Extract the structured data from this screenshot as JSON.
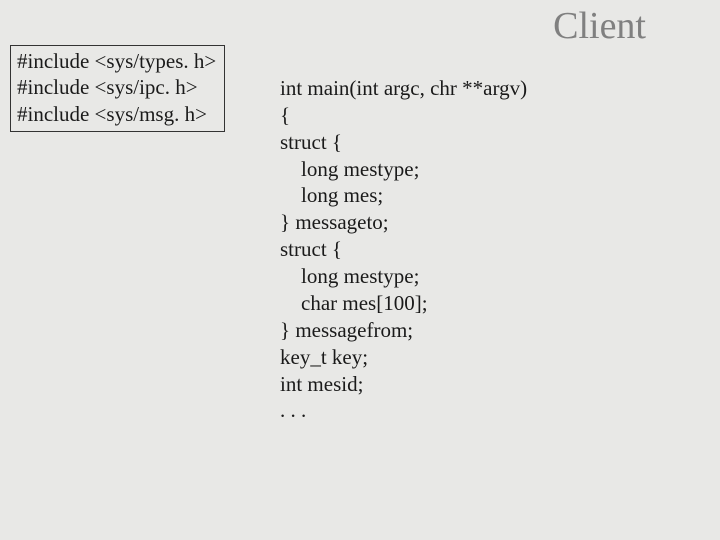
{
  "title": "Client",
  "includes": {
    "line1": "#include <sys/types. h>",
    "line2": "#include <sys/ipc. h>",
    "line3": "#include <sys/msg. h>"
  },
  "code": {
    "line1": "int main(int argc, chr **argv)",
    "line2": "{",
    "line3": "struct {",
    "line4": "    long mestype;",
    "line5": "    long mes;",
    "line6": "} messageto;",
    "line7": "struct {",
    "line8": "    long mestype;",
    "line9": "    char mes[100];",
    "line10": "} messagefrom;",
    "line11": "key_t key;",
    "line12": "int mesid;",
    "line13": ". . ."
  }
}
